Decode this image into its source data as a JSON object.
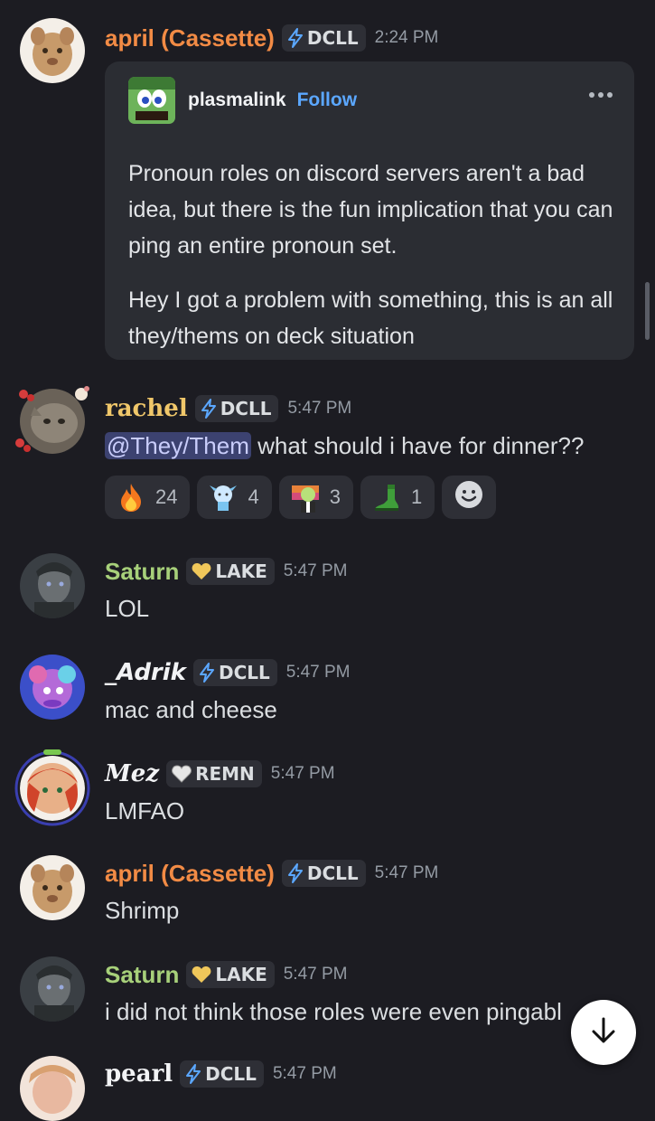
{
  "colors": {
    "background": "#1c1c22",
    "orange_name": "#f28b45",
    "yellow_name": "#f0c76a",
    "green_name": "#a7d07a",
    "white_name": "#f2f3f5",
    "link": "#5ba7ff",
    "mention_bg": "#3c4270"
  },
  "messages": {
    "m1": {
      "author": "april (Cassette)",
      "tag": "DCLL",
      "tag_icon": "lightning-icon",
      "time": "2:24 PM",
      "embed": {
        "author": "plasmalink",
        "follow": "Follow",
        "paragraph1": "Pronoun roles on discord servers aren't a bad idea, but there is the fun implication that you can ping an entire pronoun set.",
        "paragraph2": "Hey I got a problem with something, this is an all they/thems on deck situation"
      }
    },
    "m2": {
      "author": "rachel",
      "tag": "DCLL",
      "tag_icon": "lightning-icon",
      "time": "5:47 PM",
      "mention": "@They/Them",
      "text": " what should i have for dinner??",
      "reactions": [
        {
          "emoji": "fire-emoji",
          "count": "24"
        },
        {
          "emoji": "anime-girl-emoji",
          "count": "4"
        },
        {
          "emoji": "character-emoji",
          "count": "3"
        },
        {
          "emoji": "green-boot-emoji",
          "count": "1"
        }
      ]
    },
    "m3": {
      "author": "Saturn",
      "tag": "LAKE",
      "tag_icon": "yellow-heart-icon",
      "time": "5:47 PM",
      "text": "LOL"
    },
    "m4": {
      "author": "_Adrik",
      "tag": "DCLL",
      "tag_icon": "lightning-icon",
      "time": "5:47 PM",
      "text": "mac and cheese"
    },
    "m5": {
      "author": "Mez",
      "tag": "REMN",
      "tag_icon": "white-heart-icon",
      "time": "5:47 PM",
      "text": "LMFAO"
    },
    "m6": {
      "author": "april (Cassette)",
      "tag": "DCLL",
      "tag_icon": "lightning-icon",
      "time": "5:47 PM",
      "text": "Shrimp"
    },
    "m7": {
      "author": "Saturn",
      "tag": "LAKE",
      "tag_icon": "yellow-heart-icon",
      "time": "5:47 PM",
      "text": "i did not think those roles were even pingabl"
    },
    "m8": {
      "author": "pearl",
      "tag": "DCLL",
      "tag_icon": "lightning-icon",
      "time": "5:47 PM"
    }
  },
  "jump_to_bottom": "arrow-down-icon"
}
